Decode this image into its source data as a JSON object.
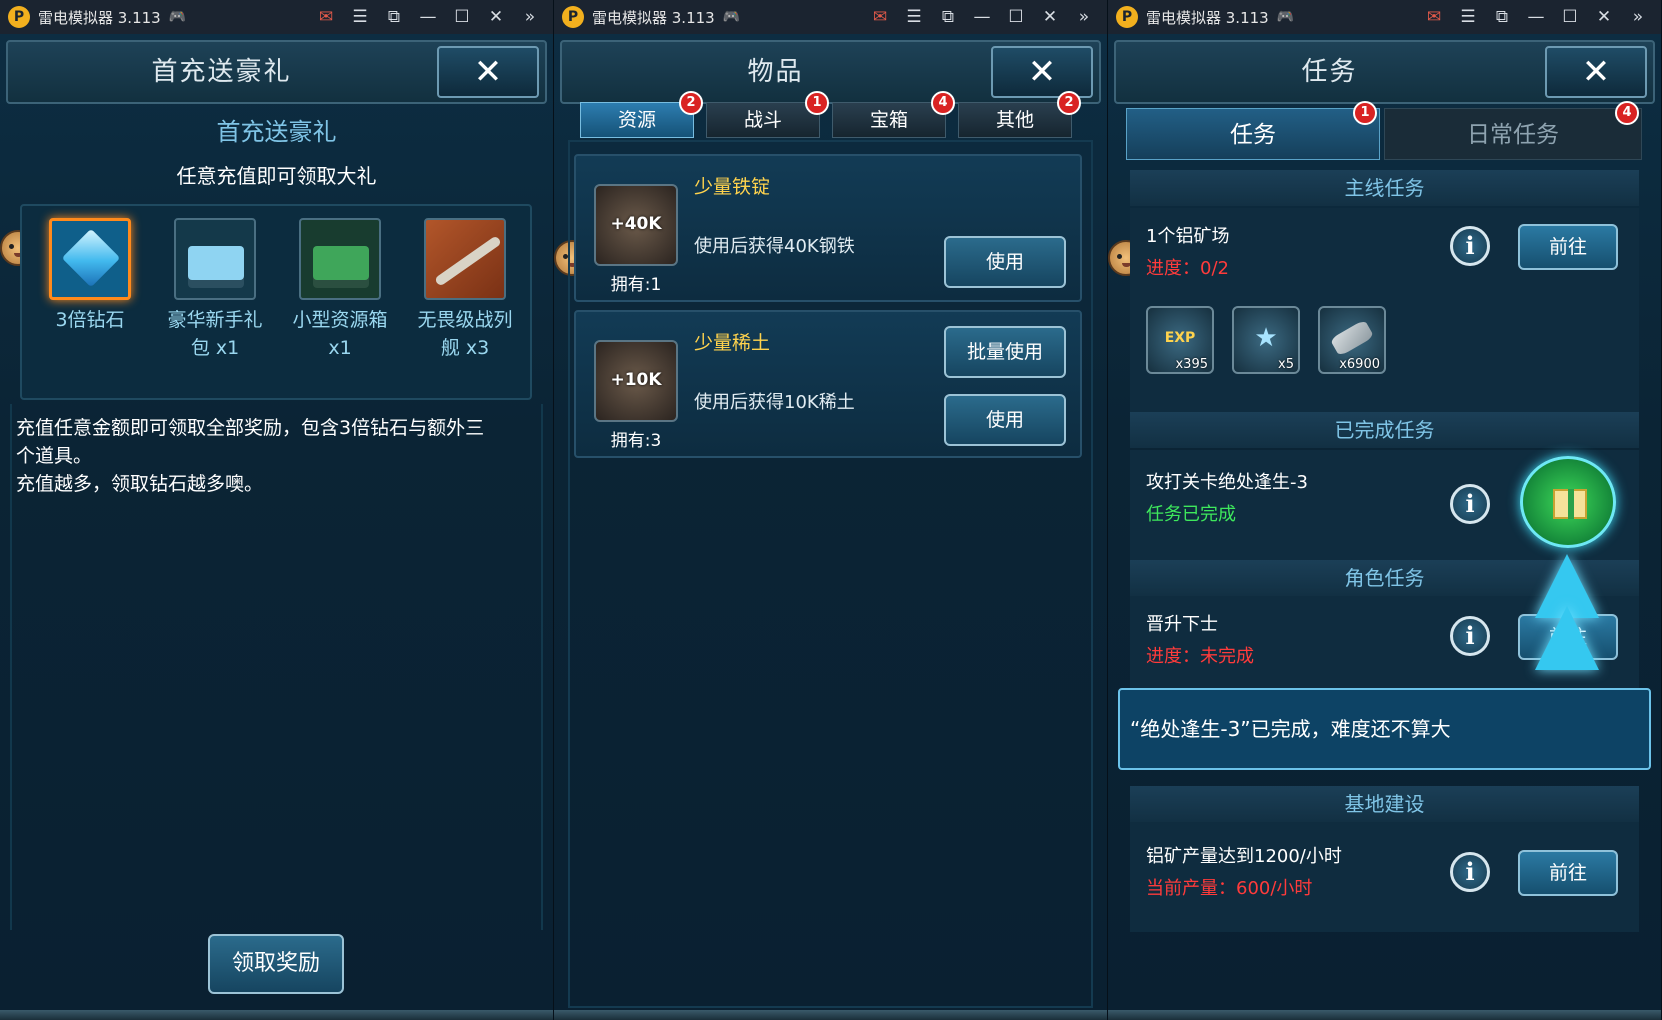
{
  "windows": [
    {
      "titlebar": {
        "app_name": "雷电模拟器 3.113",
        "logo_glyph": "P"
      },
      "header_title": "首充送豪礼",
      "close_glyph": "✕",
      "subtitle": "首充送豪礼",
      "desc": "任意充值即可领取大礼",
      "rewards": [
        {
          "label_1": "3倍钻石",
          "label_2": "",
          "icon": "diamond-icon"
        },
        {
          "label_1": "豪华新手礼",
          "label_2": "包 x1",
          "icon": "luxury-pack-icon"
        },
        {
          "label_1": "小型资源箱",
          "label_2": "x1",
          "icon": "resource-box-icon"
        },
        {
          "label_1": "无畏级战列",
          "label_2": "舰 x3",
          "icon": "battleship-icon"
        }
      ],
      "body_line_1": "充值任意金额即可领取全部奖励，包含3倍钻石与额外三",
      "body_line_2": "个道具。",
      "body_line_3": "充值越多，领取钻石越多噢。",
      "claim_button": "领取奖励"
    },
    {
      "titlebar": {
        "app_name": "雷电模拟器 3.113",
        "logo_glyph": "P"
      },
      "header_title": "物品",
      "close_glyph": "✕",
      "tabs": [
        {
          "label": "资源",
          "badge": "2"
        },
        {
          "label": "战斗",
          "badge": "1"
        },
        {
          "label": "宝箱",
          "badge": "4"
        },
        {
          "label": "其他",
          "badge": "2"
        }
      ],
      "items": [
        {
          "name": "少量铁锭",
          "amount": "+40K",
          "desc": "使用后获得40K钢铁",
          "owned": "拥有:1",
          "use": "使用",
          "batch": ""
        },
        {
          "name": "少量稀土",
          "amount": "+10K",
          "desc": "使用后获得10K稀土",
          "owned": "拥有:3",
          "use": "使用",
          "batch": "批量使用"
        }
      ]
    },
    {
      "titlebar": {
        "app_name": "雷电模拟器 3.113",
        "logo_glyph": "P"
      },
      "header_title": "任务",
      "close_glyph": "✕",
      "tabs": [
        {
          "label": "任务",
          "badge": "1"
        },
        {
          "label": "日常任务",
          "badge": "4"
        }
      ],
      "sections": {
        "main": "主线任务",
        "done": "已完成任务",
        "role": "角色任务",
        "base": "基地建设"
      },
      "main_task": {
        "name": "1个铝矿场",
        "status": "进度：0/2",
        "go": "前往",
        "rewards": [
          {
            "qty": "x395",
            "icon": "exp-icon",
            "glyph": "EXP"
          },
          {
            "qty": "x5",
            "icon": "rank-badge-icon",
            "glyph": "★"
          },
          {
            "qty": "x6900",
            "icon": "aluminum-icon",
            "glyph": ""
          }
        ]
      },
      "done_task": {
        "name": "攻打关卡绝处逢生-3",
        "status": "任务已完成"
      },
      "role_task": {
        "name": "晋升下士",
        "status": "进度：未完成",
        "go": "前往"
      },
      "toast": "“绝处逢生-3”已完成，难度还不算大",
      "base_task": {
        "name": "铝矿产量达到1200/小时",
        "status": "当前产量：600/小时",
        "go": "前往"
      },
      "info_glyph": "i"
    }
  ],
  "titlebar_glyphs": {
    "gamepad": "🎮",
    "mail": "✉",
    "menu": "☰",
    "restore": "⧉",
    "min": "—",
    "max": "☐",
    "close": "✕",
    "more": "»"
  },
  "colors": {
    "accent_text": "#7fc4e6",
    "gold_text": "#ffd34d",
    "red_text": "#ff3b3b",
    "green_text": "#3ee85c",
    "badge": "#d92323"
  }
}
